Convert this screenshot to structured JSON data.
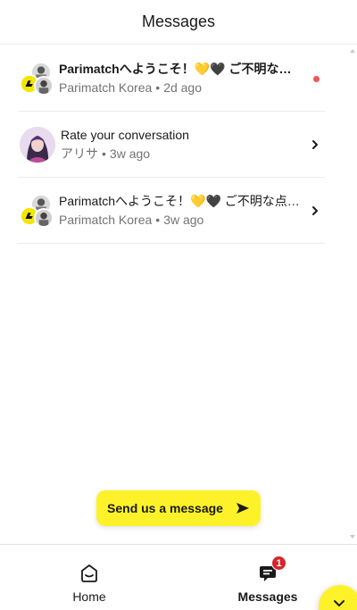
{
  "header": {
    "title": "Messages"
  },
  "conversations": [
    {
      "title": "Parimatchへようこそ！💛🖤 ご不明な点がございましたら",
      "sender": "Parimatch Korea",
      "sep": "•",
      "time": "2d ago",
      "unread": true
    },
    {
      "title": "Rate your conversation",
      "sender": "アリサ",
      "sep": "•",
      "time": "3w ago",
      "unread": false
    },
    {
      "title": "Parimatchへようこそ！💛🖤 ご不明な点がございましたら",
      "sender": "Parimatch Korea",
      "sep": "•",
      "time": "3w ago",
      "unread": false
    }
  ],
  "send_button": {
    "label": "Send us a message",
    "icon": "send-icon"
  },
  "nav": {
    "home": {
      "label": "Home",
      "icon": "home-inbox-icon"
    },
    "messages": {
      "label": "Messages",
      "icon": "messages-icon",
      "badge": "1"
    }
  },
  "launcher": {
    "icon": "chevron-down-icon"
  },
  "colors": {
    "accent": "#fdf22a",
    "unread_dot": "#f25556",
    "badge": "#d6262b",
    "muted": "#737373",
    "divider": "#ececec"
  }
}
